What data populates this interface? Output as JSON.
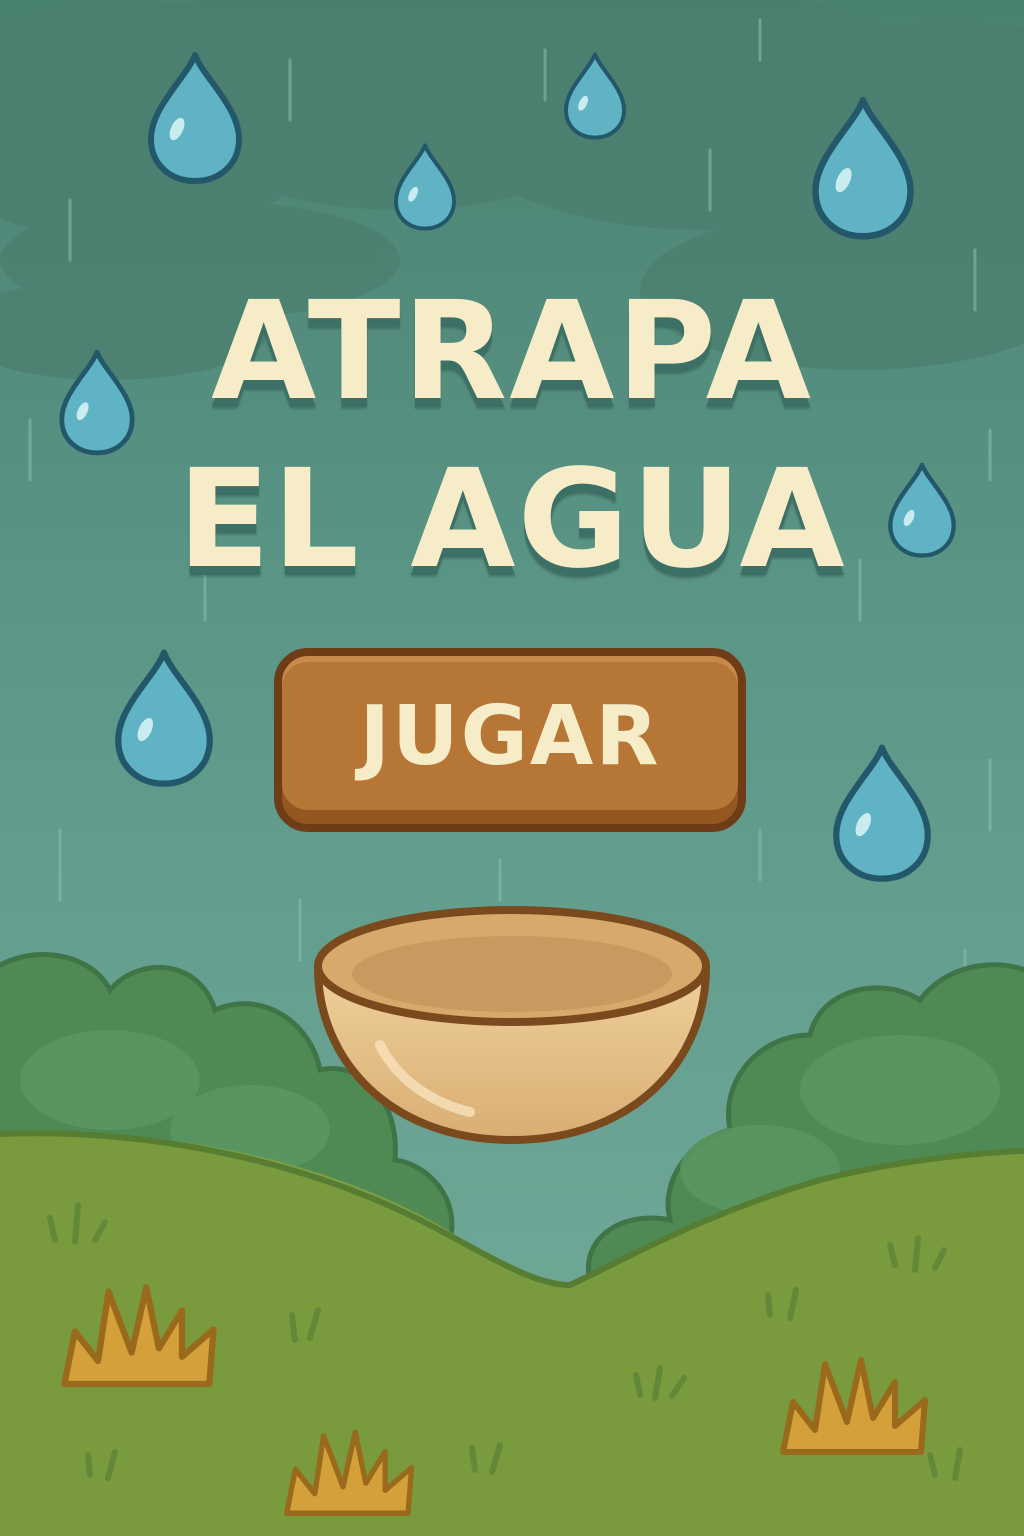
{
  "game": {
    "title_line_1": "ATRAPA",
    "title_line_2": "EL AGUA",
    "play_button_label": "JUGAR"
  },
  "colors": {
    "sky": "#5f9a8b",
    "storm_cloud": "#4f8676",
    "water_drop": "#5fb3c4",
    "drop_outline": "#23576a",
    "title_text": "#f7ecc8",
    "title_shadow": "#3c6f66",
    "button_fill": "#b57636",
    "button_border": "#6e3d18",
    "bowl": "#e6c08a",
    "bushes": "#4f8a55",
    "grass": "#7a9a3e",
    "grass_tufts": "#c4912e"
  },
  "icons": [
    "raindrop-icon",
    "bowl-icon",
    "bush-icon",
    "grass-tuft-icon"
  ]
}
